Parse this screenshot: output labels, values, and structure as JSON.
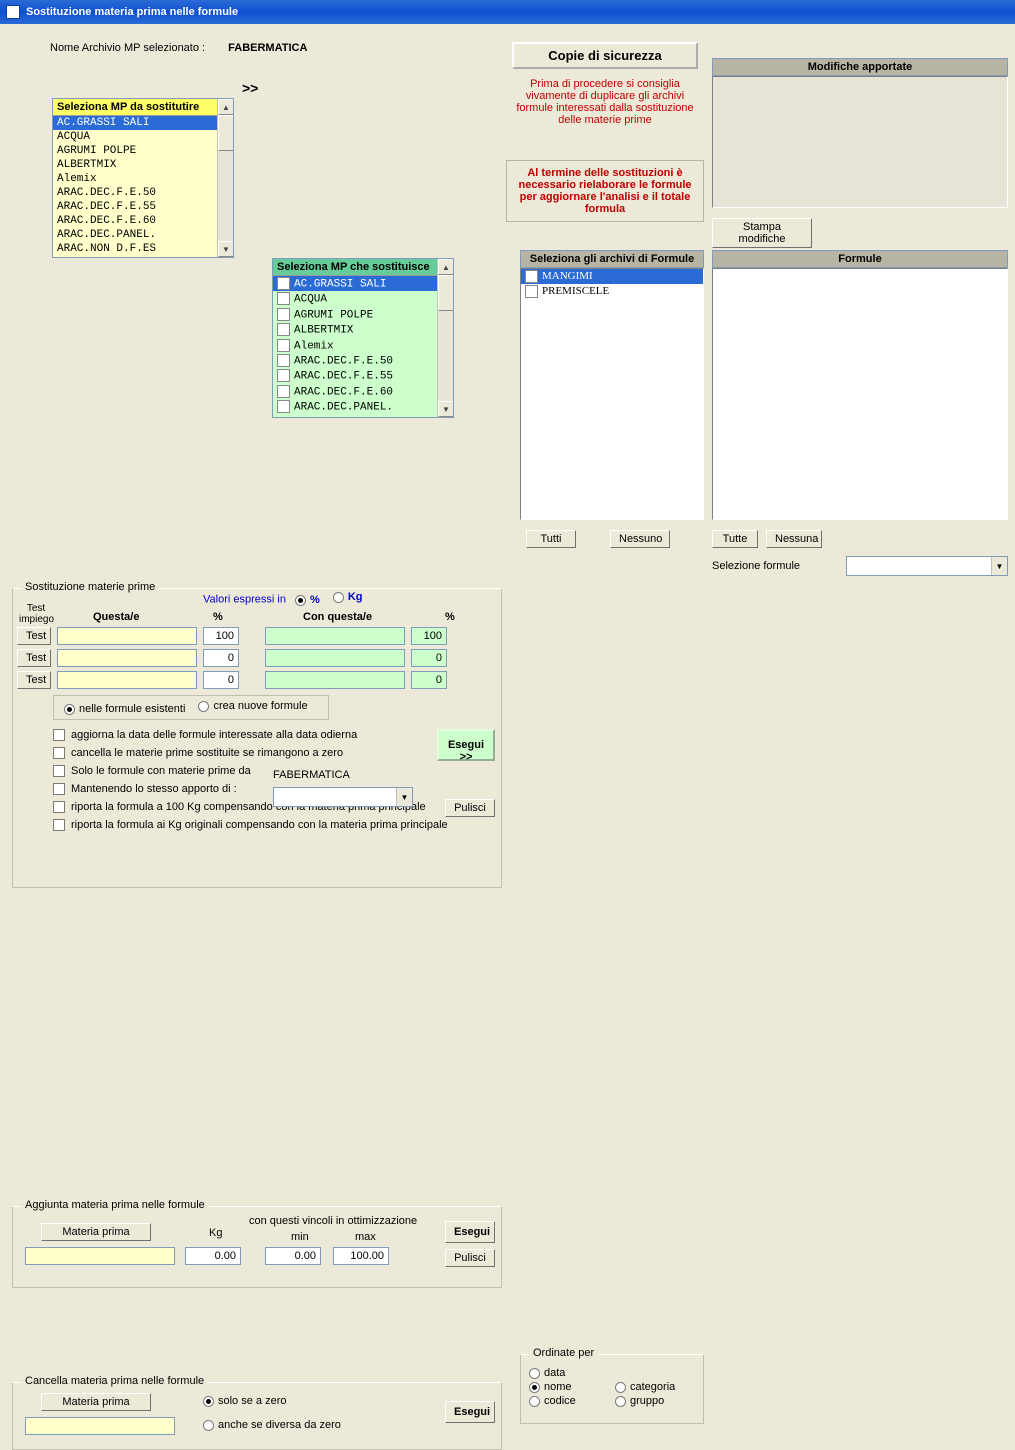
{
  "window": {
    "title": "Sostituzione materia prima nelle formule"
  },
  "archive": {
    "label": "Nome Archivio MP selezionato :",
    "value": "FABERMATICA"
  },
  "arrows": ">>",
  "lists": {
    "from_header": "Seleziona MP da sostitutire",
    "to_header": "Seleziona  MP che sostituisce",
    "from_items": [
      "AC.GRASSI SALI",
      "ACQUA",
      "AGRUMI POLPE",
      "ALBERTMIX",
      "Alemix",
      "ARAC.DEC.F.E.50",
      "ARAC.DEC.F.E.55",
      "ARAC.DEC.F.E.60",
      "ARAC.DEC.PANEL.",
      "ARAC.NON D.F.ES"
    ],
    "to_items": [
      "AC.GRASSI SALI",
      "ACQUA",
      "AGRUMI POLPE",
      "ALBERTMIX",
      "Alemix",
      "ARAC.DEC.F.E.50",
      "ARAC.DEC.F.E.55",
      "ARAC.DEC.F.E.60",
      "ARAC.DEC.PANEL."
    ]
  },
  "backup": {
    "button": "Copie di sicurezza",
    "note": "Prima di procedere si  consiglia vivamente di duplicare gli archivi formule interessati dalla sostituzione delle materie prime",
    "warn": "Al termine delle sostituzioni è necessario rielaborare le formule per aggiornare l'analisi e il totale formula"
  },
  "modlog": {
    "header": "Modifiche apportate",
    "print": "Stampa modifiche"
  },
  "subst": {
    "group": "Sostituzione materie prime",
    "expr": "Valori espressi in",
    "unit_pct": "%",
    "unit_kg": "Kg",
    "test_label": "Test impiego",
    "test": "Test",
    "col_a": "Questa/e",
    "col_b": "Con questa/e",
    "pct": "%",
    "rows": [
      {
        "a": "",
        "ap": "100",
        "b": "",
        "bp": "100"
      },
      {
        "a": "",
        "ap": "0",
        "b": "",
        "bp": "0"
      },
      {
        "a": "",
        "ap": "0",
        "b": "",
        "bp": "0"
      }
    ],
    "opt_existing": "nelle formule esistenti",
    "opt_new": "crea nuove formule",
    "chk_date": "aggiorna la data delle formule interessate alla data odierna",
    "chk_zero": "cancella le materie prime sostituite se rimangono a zero",
    "chk_only": "Solo le formule con materie prime da",
    "only_src": "FABERMATICA",
    "chk_keep": "Mantenendo lo stesso apporto di :",
    "chk_100": "riporta la formula a 100 Kg compensando con la materia prima principale",
    "chk_orig": "riporta la formula ai Kg originali compensando con la materia prima principale",
    "exec": "Esegui >>",
    "clean": "Pulisci"
  },
  "add": {
    "group": "Aggiunta materia prima nelle formule",
    "mp": "Materia prima",
    "kg": "Kg",
    "hint": "con questi vincoli in ottimizzazione",
    "min": "min",
    "max": "max",
    "kg_val": "0.00",
    "min_val": "0.00",
    "max_val": "100.00",
    "exec": "Esegui",
    "clean": "Pulisci"
  },
  "del": {
    "group": "Cancella materia prima nelle formule",
    "mp": "Materia prima",
    "only_zero": "solo se a zero",
    "also_nz": "anche se diversa da zero",
    "exec": "Esegui"
  },
  "formArch": {
    "header": "Seleziona gli archivi di Formule",
    "items": [
      "MANGIMI",
      "PREMISCELE"
    ],
    "all": "Tutti",
    "none": "Nessuno",
    "order_label": "Ordinate per",
    "order": {
      "data": "data",
      "nome": "nome",
      "codice": "codice",
      "categoria": "categoria",
      "gruppo": "gruppo"
    }
  },
  "formule": {
    "header": "Formule",
    "all": "Tutte",
    "none": "Nessuna",
    "sel_label": "Selezione formule"
  }
}
